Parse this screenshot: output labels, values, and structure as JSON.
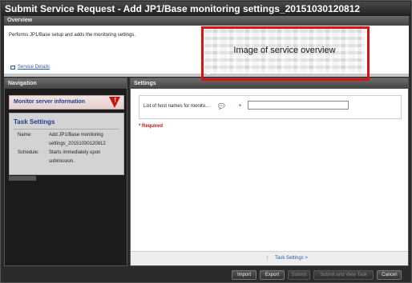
{
  "window": {
    "title": "Submit Service Request - Add JP1/Base monitoring settings_20151030120812"
  },
  "overview": {
    "header": "Overview",
    "description": "Performs JP1/Base setup and adds the monitoring settings.",
    "service_details_link": "Service Details",
    "image_caption": "Image of service overview"
  },
  "navigation": {
    "header": "Navigation",
    "active_item": "Monitor server information",
    "task_settings": {
      "title": "Task Settings",
      "name_label": "Name:",
      "name_value": "Add JP1/Base monitoring settings_20151030120812",
      "schedule_label": "Schedule:",
      "schedule_value": "Starts immediately upon submission."
    }
  },
  "settings": {
    "header": "Settings",
    "field_label": "List of host names for monito...",
    "required_mark": "*",
    "required_note": "* Required",
    "footer_separator": "|",
    "footer_link": "Task Settings >"
  },
  "buttons": {
    "import": "Import",
    "export": "Export",
    "submit": "Submit",
    "submit_view": "Submit and View Task",
    "cancel": "Cancel"
  },
  "colors": {
    "accent_red": "#d11",
    "link_blue": "#2a5fa8",
    "nav_title_blue": "#1f3f8f"
  }
}
